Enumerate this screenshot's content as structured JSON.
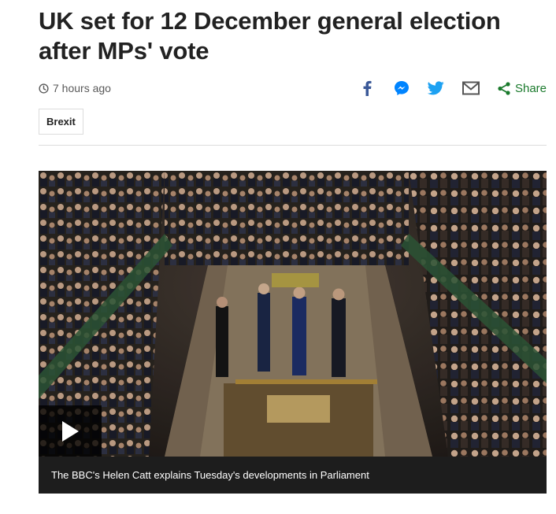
{
  "article": {
    "headline": "UK set for 12 December general election after MPs' vote",
    "timestamp": "7 hours ago",
    "tag": "Brexit"
  },
  "share": {
    "label": "Share",
    "icons": [
      "facebook-icon",
      "messenger-icon",
      "twitter-icon",
      "email-icon",
      "share-icon"
    ]
  },
  "media": {
    "caption": "The BBC's Helen Catt explains Tuesday's developments in Parliament",
    "play_icon": "play-icon"
  },
  "colors": {
    "facebook": "#3b5998",
    "messenger": "#0084ff",
    "twitter": "#1da1f2",
    "email": "#555555",
    "share": "#1a7a2c",
    "headline": "#222222"
  }
}
